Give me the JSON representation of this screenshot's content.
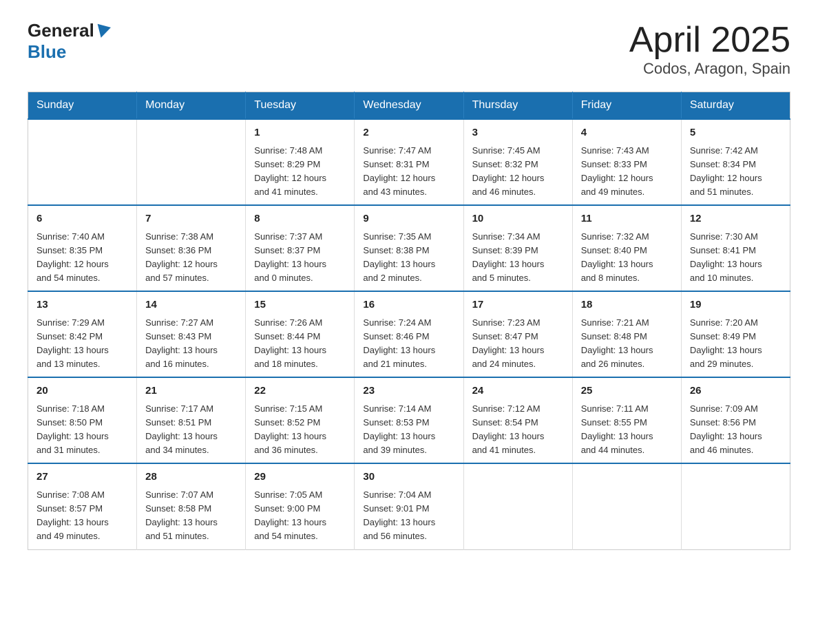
{
  "header": {
    "logo_general": "General",
    "logo_blue": "Blue",
    "title": "April 2025",
    "subtitle": "Codos, Aragon, Spain"
  },
  "days_of_week": [
    "Sunday",
    "Monday",
    "Tuesday",
    "Wednesday",
    "Thursday",
    "Friday",
    "Saturday"
  ],
  "weeks": [
    [
      {
        "day": "",
        "info": ""
      },
      {
        "day": "",
        "info": ""
      },
      {
        "day": "1",
        "info": "Sunrise: 7:48 AM\nSunset: 8:29 PM\nDaylight: 12 hours\nand 41 minutes."
      },
      {
        "day": "2",
        "info": "Sunrise: 7:47 AM\nSunset: 8:31 PM\nDaylight: 12 hours\nand 43 minutes."
      },
      {
        "day": "3",
        "info": "Sunrise: 7:45 AM\nSunset: 8:32 PM\nDaylight: 12 hours\nand 46 minutes."
      },
      {
        "day": "4",
        "info": "Sunrise: 7:43 AM\nSunset: 8:33 PM\nDaylight: 12 hours\nand 49 minutes."
      },
      {
        "day": "5",
        "info": "Sunrise: 7:42 AM\nSunset: 8:34 PM\nDaylight: 12 hours\nand 51 minutes."
      }
    ],
    [
      {
        "day": "6",
        "info": "Sunrise: 7:40 AM\nSunset: 8:35 PM\nDaylight: 12 hours\nand 54 minutes."
      },
      {
        "day": "7",
        "info": "Sunrise: 7:38 AM\nSunset: 8:36 PM\nDaylight: 12 hours\nand 57 minutes."
      },
      {
        "day": "8",
        "info": "Sunrise: 7:37 AM\nSunset: 8:37 PM\nDaylight: 13 hours\nand 0 minutes."
      },
      {
        "day": "9",
        "info": "Sunrise: 7:35 AM\nSunset: 8:38 PM\nDaylight: 13 hours\nand 2 minutes."
      },
      {
        "day": "10",
        "info": "Sunrise: 7:34 AM\nSunset: 8:39 PM\nDaylight: 13 hours\nand 5 minutes."
      },
      {
        "day": "11",
        "info": "Sunrise: 7:32 AM\nSunset: 8:40 PM\nDaylight: 13 hours\nand 8 minutes."
      },
      {
        "day": "12",
        "info": "Sunrise: 7:30 AM\nSunset: 8:41 PM\nDaylight: 13 hours\nand 10 minutes."
      }
    ],
    [
      {
        "day": "13",
        "info": "Sunrise: 7:29 AM\nSunset: 8:42 PM\nDaylight: 13 hours\nand 13 minutes."
      },
      {
        "day": "14",
        "info": "Sunrise: 7:27 AM\nSunset: 8:43 PM\nDaylight: 13 hours\nand 16 minutes."
      },
      {
        "day": "15",
        "info": "Sunrise: 7:26 AM\nSunset: 8:44 PM\nDaylight: 13 hours\nand 18 minutes."
      },
      {
        "day": "16",
        "info": "Sunrise: 7:24 AM\nSunset: 8:46 PM\nDaylight: 13 hours\nand 21 minutes."
      },
      {
        "day": "17",
        "info": "Sunrise: 7:23 AM\nSunset: 8:47 PM\nDaylight: 13 hours\nand 24 minutes."
      },
      {
        "day": "18",
        "info": "Sunrise: 7:21 AM\nSunset: 8:48 PM\nDaylight: 13 hours\nand 26 minutes."
      },
      {
        "day": "19",
        "info": "Sunrise: 7:20 AM\nSunset: 8:49 PM\nDaylight: 13 hours\nand 29 minutes."
      }
    ],
    [
      {
        "day": "20",
        "info": "Sunrise: 7:18 AM\nSunset: 8:50 PM\nDaylight: 13 hours\nand 31 minutes."
      },
      {
        "day": "21",
        "info": "Sunrise: 7:17 AM\nSunset: 8:51 PM\nDaylight: 13 hours\nand 34 minutes."
      },
      {
        "day": "22",
        "info": "Sunrise: 7:15 AM\nSunset: 8:52 PM\nDaylight: 13 hours\nand 36 minutes."
      },
      {
        "day": "23",
        "info": "Sunrise: 7:14 AM\nSunset: 8:53 PM\nDaylight: 13 hours\nand 39 minutes."
      },
      {
        "day": "24",
        "info": "Sunrise: 7:12 AM\nSunset: 8:54 PM\nDaylight: 13 hours\nand 41 minutes."
      },
      {
        "day": "25",
        "info": "Sunrise: 7:11 AM\nSunset: 8:55 PM\nDaylight: 13 hours\nand 44 minutes."
      },
      {
        "day": "26",
        "info": "Sunrise: 7:09 AM\nSunset: 8:56 PM\nDaylight: 13 hours\nand 46 minutes."
      }
    ],
    [
      {
        "day": "27",
        "info": "Sunrise: 7:08 AM\nSunset: 8:57 PM\nDaylight: 13 hours\nand 49 minutes."
      },
      {
        "day": "28",
        "info": "Sunrise: 7:07 AM\nSunset: 8:58 PM\nDaylight: 13 hours\nand 51 minutes."
      },
      {
        "day": "29",
        "info": "Sunrise: 7:05 AM\nSunset: 9:00 PM\nDaylight: 13 hours\nand 54 minutes."
      },
      {
        "day": "30",
        "info": "Sunrise: 7:04 AM\nSunset: 9:01 PM\nDaylight: 13 hours\nand 56 minutes."
      },
      {
        "day": "",
        "info": ""
      },
      {
        "day": "",
        "info": ""
      },
      {
        "day": "",
        "info": ""
      }
    ]
  ]
}
